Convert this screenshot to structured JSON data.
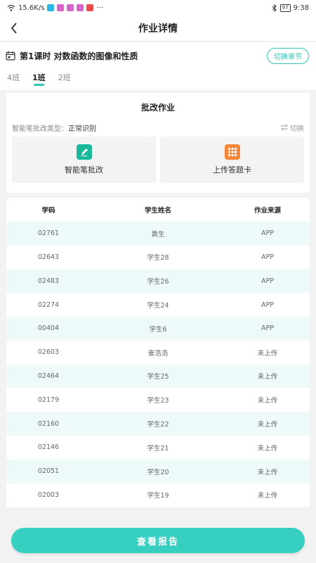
{
  "status_bar": {
    "speed": "15.6K/s",
    "more": "···",
    "battery": "97",
    "time": "9:38"
  },
  "nav": {
    "title": "作业详情"
  },
  "lesson": {
    "title": "第1课时 对数函数的图像和性质",
    "switch_label": "切换章节"
  },
  "tabs": [
    {
      "label": "4班",
      "active": false
    },
    {
      "label": "1班",
      "active": true
    },
    {
      "label": "2班",
      "active": false
    }
  ],
  "correct": {
    "title": "批改作业",
    "type_label": "智能笔批改类型：",
    "type_value": "正常识别",
    "switch_label": "切换",
    "options": [
      {
        "label": "智能笔批改",
        "icon": "pen-icon",
        "color": "#1ab99a"
      },
      {
        "label": "上传答题卡",
        "icon": "grid-icon",
        "color": "#f5883a"
      }
    ]
  },
  "table": {
    "columns": [
      "学码",
      "学生姓名",
      "作业来源"
    ],
    "rows": [
      [
        "02761",
        "黄生",
        "APP"
      ],
      [
        "02643",
        "学生28",
        "APP"
      ],
      [
        "02483",
        "学生26",
        "APP"
      ],
      [
        "02274",
        "学生24",
        "APP"
      ],
      [
        "00404",
        "学生6",
        "APP"
      ],
      [
        "02603",
        "崔浩浩",
        "未上传"
      ],
      [
        "02464",
        "学生25",
        "未上传"
      ],
      [
        "02179",
        "学生23",
        "未上传"
      ],
      [
        "02160",
        "学生22",
        "未上传"
      ],
      [
        "02146",
        "学生21",
        "未上传"
      ],
      [
        "02051",
        "学生20",
        "未上传"
      ],
      [
        "02003",
        "学生19",
        "未上传"
      ]
    ]
  },
  "footer": {
    "report_label": "查看报告"
  },
  "colors": {
    "accent": "#36cfc0",
    "row_alt": "#eefafa"
  }
}
